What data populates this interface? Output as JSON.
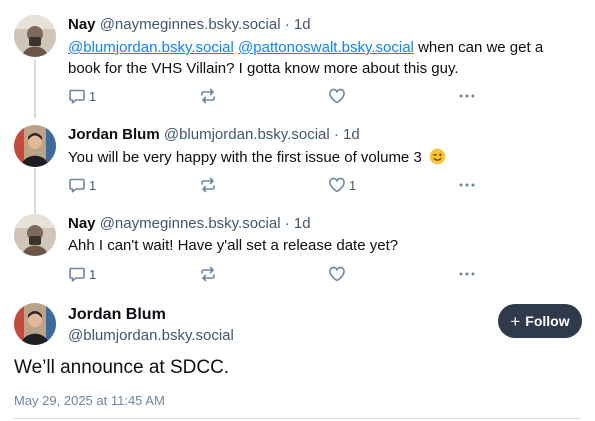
{
  "posts": [
    {
      "author_name": "Nay",
      "author_handle": "@naymeginnes.bsky.social",
      "time": "· 1d",
      "mention_1": "@blumjordan.bsky.social",
      "mention_2": "@pattonoswalt.bsky.social",
      "body": " when can we get a book for the VHS Villain? I gotta know more about this guy.",
      "replies": "1",
      "likes": ""
    },
    {
      "author_name": "Jordan Blum",
      "author_handle": "@blumjordan.bsky.social",
      "time": "· 1d",
      "body": "You will be very happy with the first issue of volume 3",
      "emoji": "winking-face",
      "replies": "1",
      "likes": "1"
    },
    {
      "author_name": "Nay",
      "author_handle": "@naymeginnes.bsky.social",
      "time": "· 1d",
      "body": "Ahh I can't wait! Have y'all set a release date yet?",
      "replies": "1",
      "likes": ""
    }
  ],
  "focused_post": {
    "author_name": "Jordan Blum",
    "author_handle": "@blumjordan.bsky.social",
    "follow_label": "Follow",
    "follow_icon": "plus-icon",
    "body": "We’ll announce at SDCC.",
    "timestamp": "May 29, 2025 at 11:45 AM"
  },
  "colors": {
    "text": "#0b0f14",
    "muted": "#42576c",
    "icon": "#6f869f",
    "link": "#1083fe",
    "thread_line": "#d4dbe2",
    "follow_bg": "#2f3b4a"
  }
}
